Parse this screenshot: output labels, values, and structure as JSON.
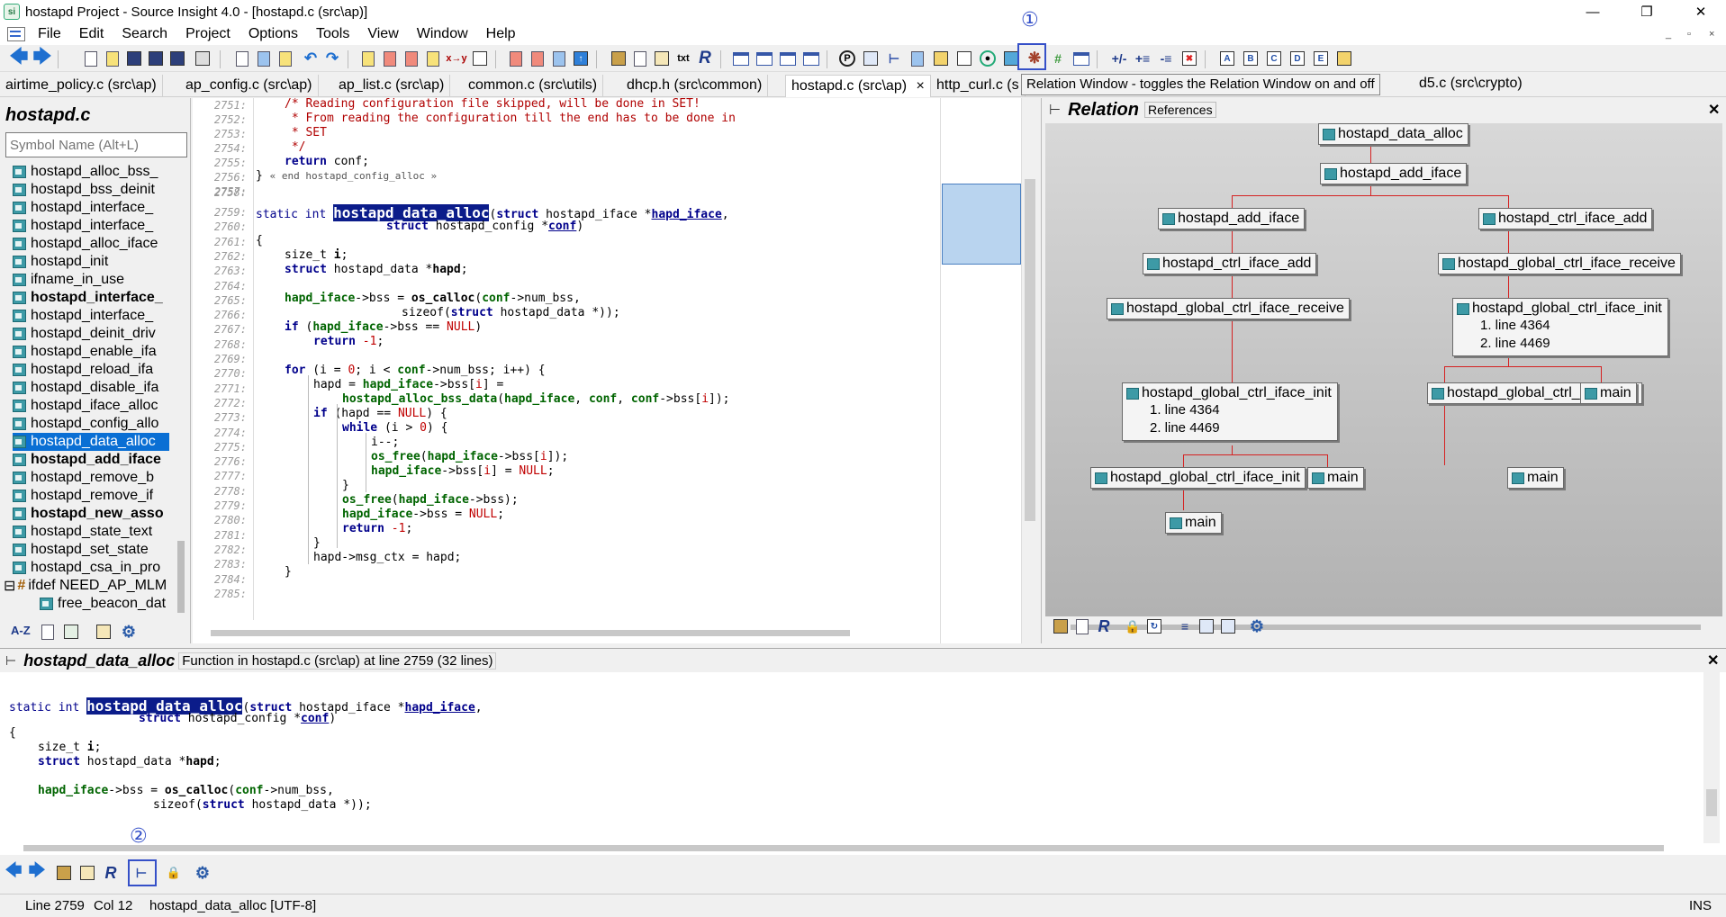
{
  "window": {
    "title": "hostapd Project - Source Insight 4.0 - [hostapd.c (src\\ap)]",
    "min_icon": "minimize-icon",
    "max_icon": "maximize-icon",
    "close_icon": "close-icon"
  },
  "menu": [
    "File",
    "Edit",
    "Search",
    "Project",
    "Options",
    "Tools",
    "View",
    "Window",
    "Help"
  ],
  "mdi_controls": [
    "_",
    "▫",
    "×"
  ],
  "callouts": {
    "one": "①",
    "two": "②"
  },
  "tabs": [
    "airtime_policy.c (src\\ap)",
    "ap_config.c (src\\ap)",
    "ap_list.c (src\\ap)",
    "common.c (src\\utils)",
    "dhcp.h (src\\common)",
    "hostapd.c (src\\ap)",
    "http_curl.c (s"
  ],
  "tab_close": "×",
  "tab_tail": "d5.c (src\\crypto)",
  "tooltip": "Relation Window - toggles the Relation Window on and off",
  "symbol_panel": {
    "file_title": "hostapd.c",
    "search_placeholder": "Symbol Name (Alt+L)",
    "symbols": [
      {
        "name": "hostapd_alloc_bss_",
        "bold": false
      },
      {
        "name": "hostapd_bss_deinit",
        "bold": false
      },
      {
        "name": "hostapd_interface_",
        "bold": false
      },
      {
        "name": "hostapd_interface_",
        "bold": false
      },
      {
        "name": "hostapd_alloc_iface",
        "bold": false
      },
      {
        "name": "hostapd_init",
        "bold": false
      },
      {
        "name": "ifname_in_use",
        "bold": false
      },
      {
        "name": "hostapd_interface_",
        "bold": true
      },
      {
        "name": "hostapd_interface_",
        "bold": false
      },
      {
        "name": "hostapd_deinit_driv",
        "bold": false
      },
      {
        "name": "hostapd_enable_ifa",
        "bold": false
      },
      {
        "name": "hostapd_reload_ifa",
        "bold": false
      },
      {
        "name": "hostapd_disable_ifa",
        "bold": false
      },
      {
        "name": "hostapd_iface_alloc",
        "bold": false
      },
      {
        "name": "hostapd_config_allo",
        "bold": false
      },
      {
        "name": "hostapd_data_alloc",
        "bold": false,
        "selected": true
      },
      {
        "name": "hostapd_add_iface",
        "bold": true
      },
      {
        "name": "hostapd_remove_b",
        "bold": false
      },
      {
        "name": "hostapd_remove_if",
        "bold": false
      },
      {
        "name": "hostapd_new_asso",
        "bold": true
      },
      {
        "name": "hostapd_state_text",
        "bold": false
      },
      {
        "name": "hostapd_set_state",
        "bold": false
      },
      {
        "name": "hostapd_csa_in_pro",
        "bold": false
      },
      {
        "name": "ifdef NEED_AP_MLM",
        "bold": false,
        "ifdef": true
      },
      {
        "name": "free_beacon_dat",
        "bold": false,
        "sub": true
      }
    ],
    "tools": [
      "A-Z"
    ]
  },
  "editor": {
    "line_numbers": [
      "2751:",
      "2752:",
      "2753:",
      "2754:",
      "2755:",
      "2756:",
      "2757:",
      "2758:",
      "2759:",
      "2760:",
      "2761:",
      "2762:",
      "2763:",
      "2764:",
      "2765:",
      "2766:",
      "2767:",
      "2768:",
      "2769:",
      "2770:",
      "2771:",
      "2772:",
      "2773:",
      "2774:",
      "2775:",
      "2776:",
      "2777:",
      "2778:",
      "2779:",
      "2780:",
      "2781:",
      "2782:",
      "2783:",
      "2784:",
      "2785:"
    ],
    "code": {
      "l2751": "/* Reading configuration file skipped, will be done in SET!",
      "l2752": " * From reading the configuration till the end has to be done in",
      "l2753": " * SET",
      "l2754": " */",
      "l2755_kw": "return",
      "l2755_rest": " conf;",
      "l2756_a": "} ",
      "l2756_b": "« end hostapd_config_alloc »",
      "l2759_a": "static int ",
      "l2759_fn": "hostapd_data_alloc",
      "l2759_b": "(",
      "l2759_kw": "struct",
      "l2759_c": " hostapd_iface *",
      "l2759_p": "hapd_iface",
      "l2759_d": ",",
      "l2760_kw": "struct",
      "l2760_a": " hostapd_config *",
      "l2760_p": "conf",
      "l2760_b": ")",
      "l2761": "{",
      "l2762_a": "size_t ",
      "l2762_b": "i",
      "l2762_c": ";",
      "l2763_kw": "struct",
      "l2763_a": " hostapd_data *",
      "l2763_b": "hapd",
      "l2763_c": ";",
      "l2765_p": "hapd_iface",
      "l2765_a": "->bss = ",
      "l2765_fn": "os_calloc",
      "l2765_b": "(",
      "l2765_p2": "conf",
      "l2765_c": "->num_bss,",
      "l2766_a": "sizeof(",
      "l2766_kw": "struct",
      "l2766_b": " hostapd_data *));",
      "l2767_kw": "if",
      "l2767_a": " (",
      "l2767_p": "hapd_iface",
      "l2767_b": "->bss == ",
      "l2767_n": "NULL",
      "l2767_c": ")",
      "l2768_kw": "return",
      "l2768_a": " ",
      "l2768_n": "-1",
      "l2768_b": ";",
      "l2770_kw": "for",
      "l2770_a": " (i = ",
      "l2770_n": "0",
      "l2770_b": "; i < ",
      "l2770_p": "conf",
      "l2770_c": "->num_bss; i++) {",
      "l2771_a": "hapd = ",
      "l2771_p": "hapd_iface",
      "l2771_b": "->bss[",
      "l2771_i": "i",
      "l2771_c": "] =",
      "l2772_fn": "hostapd_alloc_bss_data",
      "l2772_a": "(",
      "l2772_p": "hapd_iface",
      "l2772_b": ", ",
      "l2772_p2": "conf",
      "l2772_c": ", ",
      "l2772_p3": "conf",
      "l2772_d": "->bss[",
      "l2772_i": "i",
      "l2772_e": "]);",
      "l2773_kw": "if",
      "l2773_a": " (hapd == ",
      "l2773_n": "NULL",
      "l2773_b": ") {",
      "l2774_kw": "while",
      "l2774_a": " (i > ",
      "l2774_n": "0",
      "l2774_b": ") {",
      "l2775": "i--;",
      "l2776_fn": "os_free",
      "l2776_a": "(",
      "l2776_p": "hapd_iface",
      "l2776_b": "->bss[",
      "l2776_i": "i",
      "l2776_c": "]);",
      "l2777_p": "hapd_iface",
      "l2777_a": "->bss[",
      "l2777_i": "i",
      "l2777_b": "] = ",
      "l2777_n": "NULL",
      "l2777_c": ";",
      "l2778": "}",
      "l2779_fn": "os_free",
      "l2779_a": "(",
      "l2779_p": "hapd_iface",
      "l2779_b": "->bss);",
      "l2780_p": "hapd_iface",
      "l2780_a": "->bss = ",
      "l2780_n": "NULL",
      "l2780_b": ";",
      "l2781_kw": "return",
      "l2781_a": " ",
      "l2781_n": "-1",
      "l2781_b": ";",
      "l2782": "}",
      "l2783": "hapd->msg_ctx = hapd;",
      "l2784": "}"
    }
  },
  "relation": {
    "title": "Relation",
    "subtitle": "References",
    "nodes": {
      "n1": "hostapd_data_alloc",
      "n2": "hostapd_add_iface",
      "n3": "hostapd_add_iface",
      "n4": "hostapd_ctrl_iface_add",
      "n5": "hostapd_ctrl_iface_add",
      "n6": "hostapd_global_ctrl_iface_receive",
      "n7": "hostapd_global_ctrl_iface_receive",
      "n8": "hostapd_global_ctrl_iface_init",
      "n8_r1": "1. line 4364",
      "n8_r2": "2. line 4469",
      "n9": "hostapd_global_ctrl_iface_init",
      "n9_r1": "1. line 4364",
      "n9_r2": "2. line 4469",
      "n10": "hostapd_global_ctrl_iface_init",
      "n11": "main",
      "n12": "hostapd_global_ctrl_iface_init",
      "n13": "main",
      "n14": "main",
      "n15": "main"
    }
  },
  "context": {
    "func": "hostapd_data_alloc",
    "desc": "Function in hostapd.c (src\\ap) at line 2759 (32 lines)",
    "code": {
      "c1_a": "static int ",
      "c1_fn": "hostapd_data_alloc",
      "c1_b": "(",
      "c1_kw": "struct",
      "c1_c": " hostapd_iface *",
      "c1_p": "hapd_iface",
      "c1_d": ",",
      "c2_kw": "struct",
      "c2_a": " hostapd_config *",
      "c2_p": "conf",
      "c2_b": ")",
      "c3": "{",
      "c4_a": "size_t ",
      "c4_b": "i",
      "c4_c": ";",
      "c5_kw": "struct",
      "c5_a": " hostapd_data *",
      "c5_b": "hapd",
      "c5_c": ";",
      "c6_p": "hapd_iface",
      "c6_a": "->bss = ",
      "c6_fn": "os_calloc",
      "c6_b": "(",
      "c6_p2": "conf",
      "c6_c": "->num_bss,",
      "c7_a": "sizeof(",
      "c7_kw": "struct",
      "c7_b": " hostapd_data *));"
    }
  },
  "status": {
    "line": "Line 2759",
    "col": "Col 12",
    "info": "hostapd_data_alloc [UTF-8]",
    "mode": "INS"
  },
  "colors": {
    "accent": "#3550c8",
    "selection": "#0a6fd4",
    "highlight": "#0b1c8a",
    "relation_line": "#d52222"
  }
}
